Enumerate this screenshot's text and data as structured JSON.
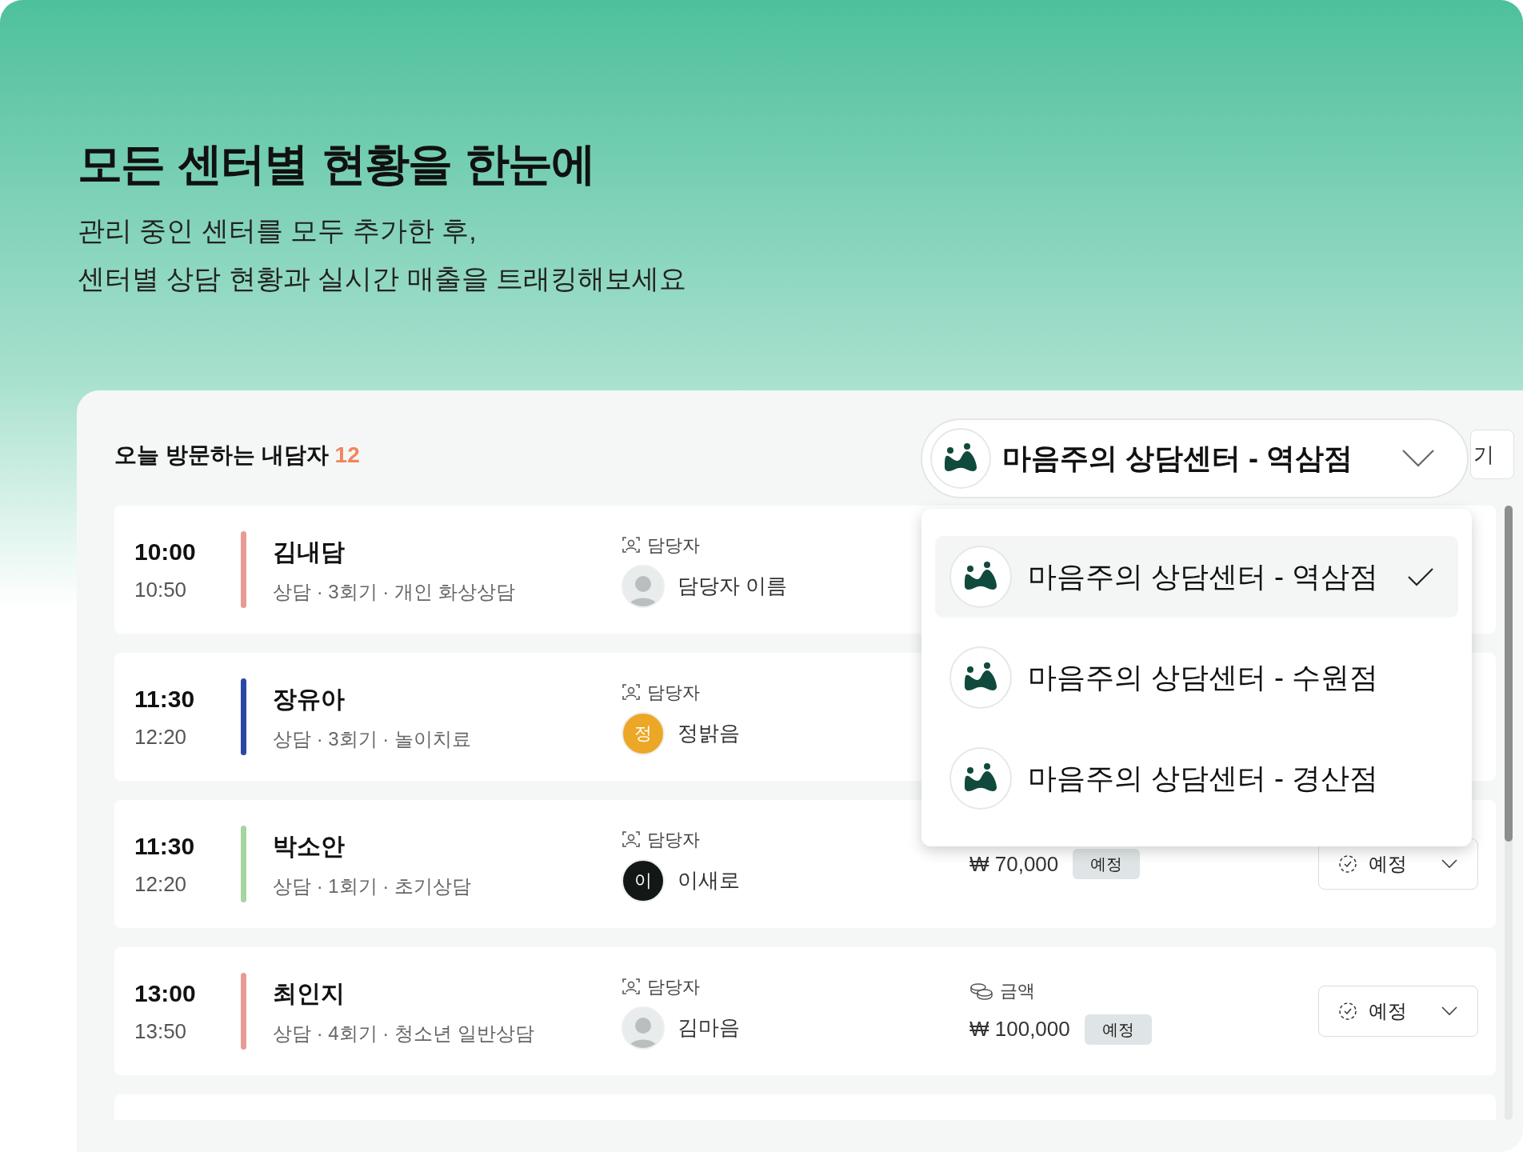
{
  "hero": {
    "title": "모든 센터별 현황을 한눈에",
    "subtitle_lines": [
      "관리 중인 센터를 모두 추가한 후,",
      "센터별 상담 현황과 실시간 매출을 트래킹해보세요"
    ]
  },
  "panel": {
    "heading": "오늘 방문하는 내담자",
    "count": "12",
    "side_button": "기",
    "center_select": {
      "value": "마음주의 상담센터 - 역삼점",
      "expanded": true,
      "options": [
        {
          "label": "마음주의 상담센터 - 역삼점",
          "selected": true
        },
        {
          "label": "마음주의 상담센터 - 수원점",
          "selected": false
        },
        {
          "label": "마음주의 상담센터 - 경산점",
          "selected": false
        }
      ]
    },
    "appointments": [
      {
        "start": "10:00",
        "end": "10:50",
        "color": "#e79b94",
        "client": "김내담",
        "details": "상담 · 3회기 · 개인 화상상담",
        "counselor_label": "담당자",
        "counselor": {
          "kind": "photo",
          "name": "담당자 이름"
        }
      },
      {
        "start": "11:30",
        "end": "12:20",
        "color": "#2a47a6",
        "client": "장유아",
        "details": "상담 · 3회기 · 놀이치료",
        "counselor_label": "담당자",
        "counselor": {
          "kind": "initial",
          "initial": "정",
          "color": "#eca726",
          "name": "정밝음"
        }
      },
      {
        "start": "11:30",
        "end": "12:20",
        "color": "#a6d6a0",
        "client": "박소안",
        "details": "상담 · 1회기 · 초기상담",
        "counselor_label": "담당자",
        "counselor": {
          "kind": "initial",
          "initial": "이",
          "color": "#111816",
          "name": "이새로"
        },
        "amount": "₩ 70,000",
        "amount_badge": "예정",
        "status": "예정"
      },
      {
        "start": "13:00",
        "end": "13:50",
        "color": "#e79b94",
        "client": "최인지",
        "details": "상담 · 4회기 · 청소년 일반상담",
        "counselor_label": "담당자",
        "counselor": {
          "kind": "photo",
          "name": "김마음"
        },
        "amount_label": "금액",
        "amount": "₩ 100,000",
        "amount_badge": "예정",
        "status": "예정"
      }
    ]
  }
}
